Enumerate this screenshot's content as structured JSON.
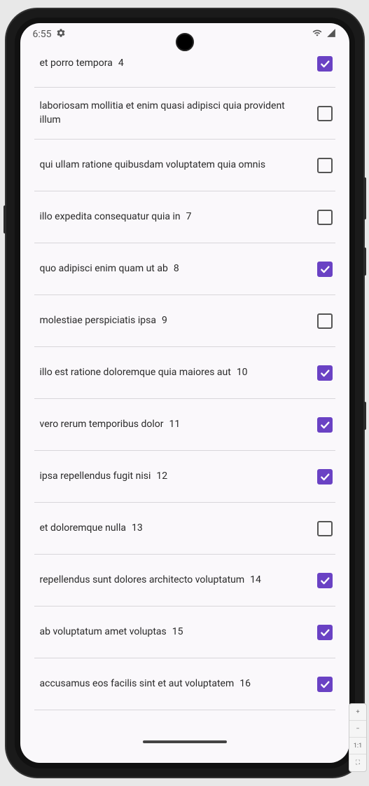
{
  "status": {
    "time": "6:55",
    "wifi": true,
    "signal": true
  },
  "items": [
    {
      "label": "et porro tempora",
      "number": "4",
      "checked": true
    },
    {
      "label": "laboriosam mollitia et enim quasi adipisci quia provident illum",
      "number": "",
      "checked": false
    },
    {
      "label": "qui ullam ratione quibusdam voluptatem quia omnis",
      "number": "",
      "checked": false
    },
    {
      "label": "illo expedita consequatur quia in",
      "number": "7",
      "checked": false
    },
    {
      "label": "quo adipisci enim quam ut ab",
      "number": "8",
      "checked": true
    },
    {
      "label": "molestiae perspiciatis ipsa",
      "number": "9",
      "checked": false
    },
    {
      "label": "illo est ratione doloremque quia maiores aut",
      "number": "10",
      "checked": true
    },
    {
      "label": "vero rerum temporibus dolor",
      "number": "11",
      "checked": true
    },
    {
      "label": "ipsa repellendus fugit nisi",
      "number": "12",
      "checked": true
    },
    {
      "label": "et doloremque nulla",
      "number": "13",
      "checked": false
    },
    {
      "label": "repellendus sunt dolores architecto voluptatum",
      "number": "14",
      "checked": true
    },
    {
      "label": "ab voluptatum amet voluptas",
      "number": "15",
      "checked": true
    },
    {
      "label": "accusamus eos facilis sint et aut voluptatem",
      "number": "16",
      "checked": true
    }
  ],
  "side_controls": {
    "plus": "+",
    "minus": "−",
    "ratio": "1:1",
    "expand": "⛶"
  },
  "colors": {
    "accent": "#6a42c4",
    "background": "#faf8fb",
    "border": "#d8d6da"
  }
}
